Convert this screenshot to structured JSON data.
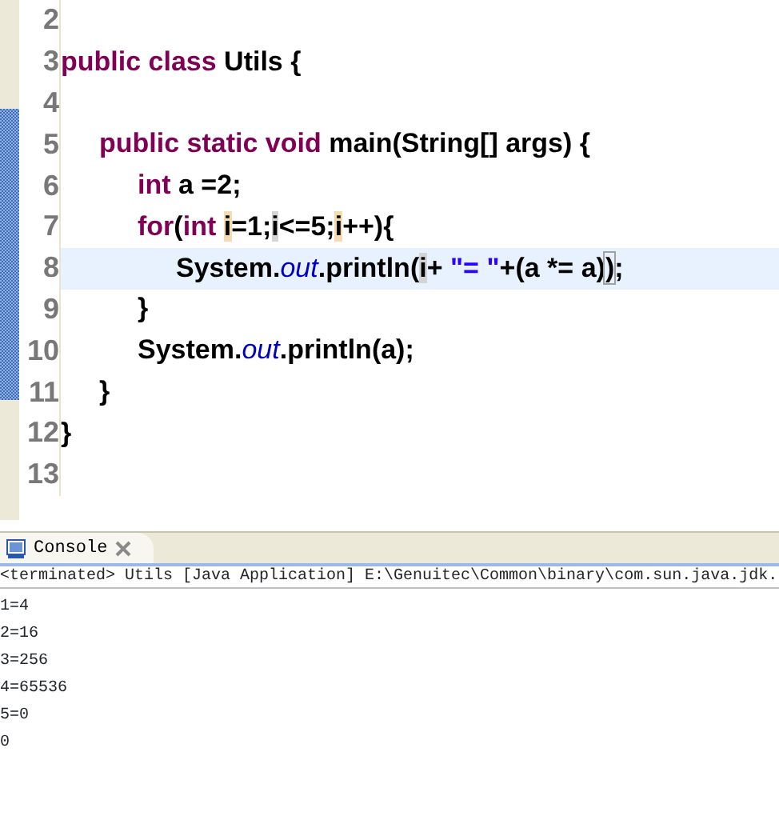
{
  "editor": {
    "lines": [
      {
        "number": "2",
        "current": false
      },
      {
        "number": "3",
        "current": false,
        "tokens": [
          {
            "kind": "keyword",
            "text": "public class"
          },
          {
            "kind": "plain",
            "text": " Utils {"
          }
        ],
        "children": [
          {
            "number": "4",
            "current": false
          },
          {
            "number": "5",
            "current": false,
            "tokens": [
              {
                "kind": "keyword",
                "text": "public static void"
              },
              {
                "kind": "plain",
                "text": " main(String[] args) {"
              }
            ],
            "children": [
              {
                "number": "6",
                "current": false,
                "tokens": [
                  {
                    "kind": "keyword",
                    "text": "int"
                  },
                  {
                    "kind": "plain",
                    "text": " a =2;"
                  }
                ]
              },
              {
                "number": "7",
                "current": false,
                "tokens": [
                  {
                    "kind": "keyword",
                    "text": "for"
                  },
                  {
                    "kind": "plain",
                    "text": "("
                  },
                  {
                    "kind": "keyword",
                    "text": "int "
                  },
                  {
                    "kind": "write-occurrence",
                    "text": "i"
                  },
                  {
                    "kind": "plain",
                    "text": "=1;"
                  },
                  {
                    "kind": "read-occurrence",
                    "text": "i"
                  },
                  {
                    "kind": "plain",
                    "text": "<=5;"
                  },
                  {
                    "kind": "write-occurrence",
                    "text": "i"
                  },
                  {
                    "kind": "plain",
                    "text": "++){"
                  }
                ],
                "children": [
                  {
                    "number": "8",
                    "current": true,
                    "tokens": [
                      {
                        "kind": "plain",
                        "text": "System."
                      },
                      {
                        "kind": "field",
                        "text": "out"
                      },
                      {
                        "kind": "plain",
                        "text": ".println("
                      },
                      {
                        "kind": "read-occurrence",
                        "text": "i"
                      },
                      {
                        "kind": "plain",
                        "text": "+ "
                      },
                      {
                        "kind": "string",
                        "text": "\"= \""
                      },
                      {
                        "kind": "plain",
                        "text": "+(a *= a)"
                      },
                      {
                        "kind": "bracket-match",
                        "text": ")"
                      },
                      {
                        "kind": "plain",
                        "text": ";"
                      }
                    ]
                  }
                ]
              },
              {
                "number": "9",
                "current": false,
                "tokens": [
                  {
                    "kind": "plain",
                    "text": "}"
                  }
                ]
              },
              {
                "number": "10",
                "current": false,
                "tokens": [
                  {
                    "kind": "plain",
                    "text": "System."
                  },
                  {
                    "kind": "field",
                    "text": "out"
                  },
                  {
                    "kind": "plain",
                    "text": ".println(a);"
                  }
                ]
              }
            ]
          },
          {
            "number": "11",
            "current": false,
            "tokens": [
              {
                "kind": "plain",
                "text": "}"
              }
            ]
          }
        ]
      },
      {
        "number": "12",
        "current": false,
        "tokens": [
          {
            "kind": "plain",
            "text": "}"
          }
        ]
      },
      {
        "number": "13",
        "current": false
      }
    ]
  },
  "console": {
    "tab": {
      "label": "Console",
      "selected": true
    },
    "header": "<terminated> Utils [Java Application] E:\\Genuitec\\Common\\binary\\com.sun.java.jdk.",
    "output": [
      "1=4",
      "2=16",
      "3=256",
      "4=65536",
      "5=0",
      "0"
    ]
  }
}
